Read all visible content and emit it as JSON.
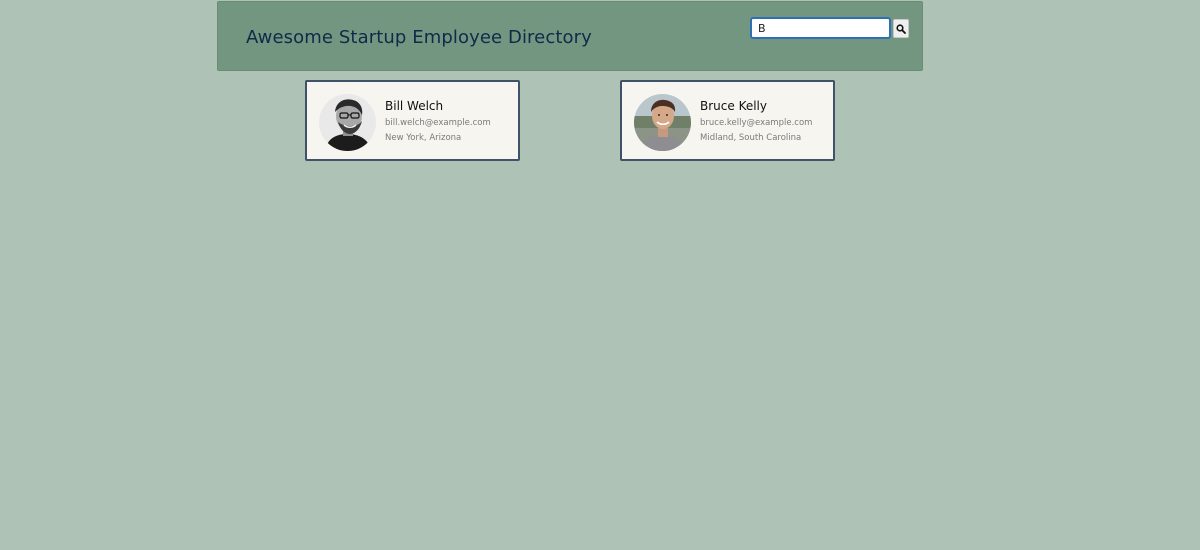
{
  "header": {
    "title": "Awesome Startup Employee Directory",
    "search_value": "B",
    "search_icon": "search-icon"
  },
  "colors": {
    "page_background": "#aec3b6",
    "header_background": "#72967f",
    "title_color": "#12294a",
    "card_background": "#f6f5f0",
    "card_border": "#3f5268"
  },
  "employees": [
    {
      "name": "Bill Welch",
      "email": "bill.welch@example.com",
      "location": "New York, Arizona"
    },
    {
      "name": "Bruce Kelly",
      "email": "bruce.kelly@example.com",
      "location": "Midland, South Carolina"
    }
  ]
}
